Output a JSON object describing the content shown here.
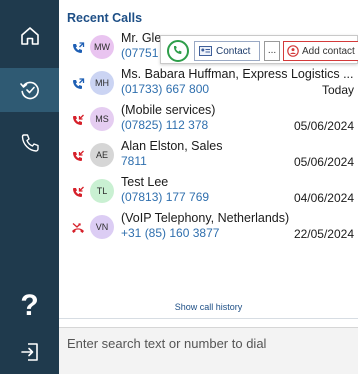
{
  "sidebar": {
    "items": [
      {
        "name": "home",
        "icon": "home-icon"
      },
      {
        "name": "recent-calls",
        "icon": "history-icon",
        "active": true
      },
      {
        "name": "phone",
        "icon": "phone-icon"
      }
    ],
    "help_label": "?",
    "logout_icon": "sign-in-icon"
  },
  "recent_calls": {
    "title": "Recent Calls",
    "rows": [
      {
        "initials": "MW",
        "name": "Mr. Gle",
        "number": "(07751",
        "date": "",
        "call_type": "outgoing",
        "avatar_color": "#e9c4f0"
      },
      {
        "initials": "MH",
        "name": "Ms. Babara Huffman, Express Logistics ...",
        "number": "(01733) 667 800",
        "date": "Today",
        "call_type": "outgoing",
        "avatar_color": "#cbd4f3"
      },
      {
        "initials": "MS",
        "name": "(Mobile services)",
        "number": "(07825) 112 378",
        "date": "05/06/2024",
        "call_type": "incoming-missed",
        "avatar_color": "#e5cdf1"
      },
      {
        "initials": "AE",
        "name": "Alan Elston, Sales",
        "number": "7811",
        "date": "05/06/2024",
        "call_type": "incoming-missed",
        "avatar_color": "#d6d6d6"
      },
      {
        "initials": "TL",
        "name": "Test Lee",
        "number": "(07813) 177 769",
        "date": "04/06/2024",
        "call_type": "incoming-missed",
        "avatar_color": "#c9f0d2"
      },
      {
        "initials": "VN",
        "name": "(VoIP Telephony, Netherlands)",
        "number": "+31 (85) 160 3877",
        "date": "22/05/2024",
        "call_type": "missed",
        "avatar_color": "#dccdf4"
      }
    ]
  },
  "popup": {
    "contact_label": "Contact",
    "more_label": "...",
    "add_contact_label": "Add contact"
  },
  "show_history_label": "Show call history",
  "search": {
    "placeholder": "Enter search text or number to dial"
  },
  "colors": {
    "sidebar_bg": "#1f3a4d",
    "sidebar_active": "#2f5a73",
    "title_blue": "#1e4f86",
    "number_blue": "#2f6fae",
    "outgoing_blue": "#1e5fb4",
    "missed_red": "#d6202a",
    "call_green": "#2e9e4a"
  }
}
